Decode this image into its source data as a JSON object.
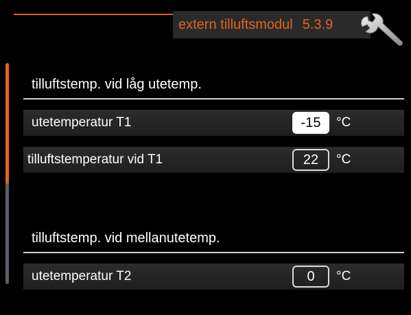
{
  "header": {
    "title": "extern tilluftsmodul",
    "menu_number": "5.3.9",
    "icon": "wrench-icon",
    "accent_color": "#e2641a"
  },
  "sections": [
    {
      "heading": "tilluftstemp. vid låg utetemp.",
      "rows": [
        {
          "label": "utetemperatur  T1",
          "value": "-15",
          "unit": "°C",
          "selected": true
        },
        {
          "label": "tilluftstemperatur vid  T1",
          "value": "22",
          "unit": "°C",
          "selected": false
        }
      ]
    },
    {
      "heading": "tilluftstemp. vid mellanutetemp.",
      "rows": [
        {
          "label": "utetemperatur  T2",
          "value": "0",
          "unit": "°C",
          "selected": false
        }
      ]
    }
  ],
  "scrollbar": {
    "visible_fraction": 0.55
  }
}
